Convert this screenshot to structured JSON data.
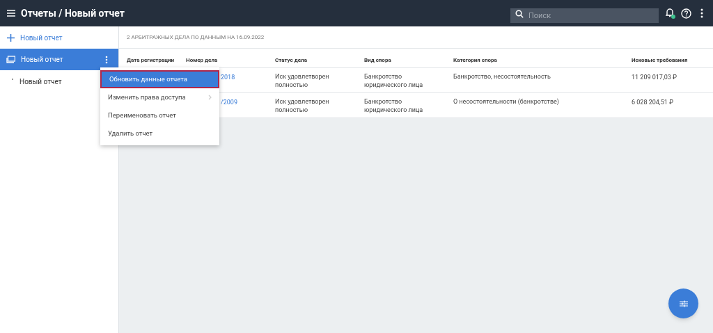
{
  "header": {
    "title": "Отчеты / Новый отчет",
    "search": {
      "placeholder": "Поиск"
    },
    "notifications_dot": true
  },
  "sidebar": {
    "add_label": "Новый отчет",
    "items": [
      {
        "label": "Новый отчет",
        "selected": true,
        "children": [
          {
            "label": "Новый отчет",
            "selected": false
          }
        ]
      }
    ]
  },
  "context_menu": {
    "items": [
      {
        "label": "Обновить данные отчета",
        "selected": true,
        "submenu": false
      },
      {
        "label": "Изменить права доступа",
        "selected": false,
        "submenu": true
      },
      {
        "label": "Переименовать отчет",
        "selected": false,
        "submenu": false
      },
      {
        "label": "Удалить отчет",
        "selected": false,
        "submenu": false
      }
    ]
  },
  "summary": "2 АРБИТРАЖНЫХ ДЕЛА ПО ДАННЫМ НА 16.09.2022",
  "table": {
    "columns": [
      "Дата регистрации",
      "Номер дела",
      "Статус дела",
      "Вид спора",
      "Категория спора",
      "Исковые требования"
    ],
    "rows": [
      [
        "",
        "2018",
        "Иск удовлетворен полностью",
        "Банкротство юридического лица",
        "Банкротство, несостоятельность",
        "11 209 017,03 ₽"
      ],
      [
        "",
        "/2009",
        "Иск удовлетворен полностью",
        "Банкротство юридического лица",
        "О несостоятельности (банкротстве)",
        "6 028 204,51 ₽"
      ]
    ]
  }
}
